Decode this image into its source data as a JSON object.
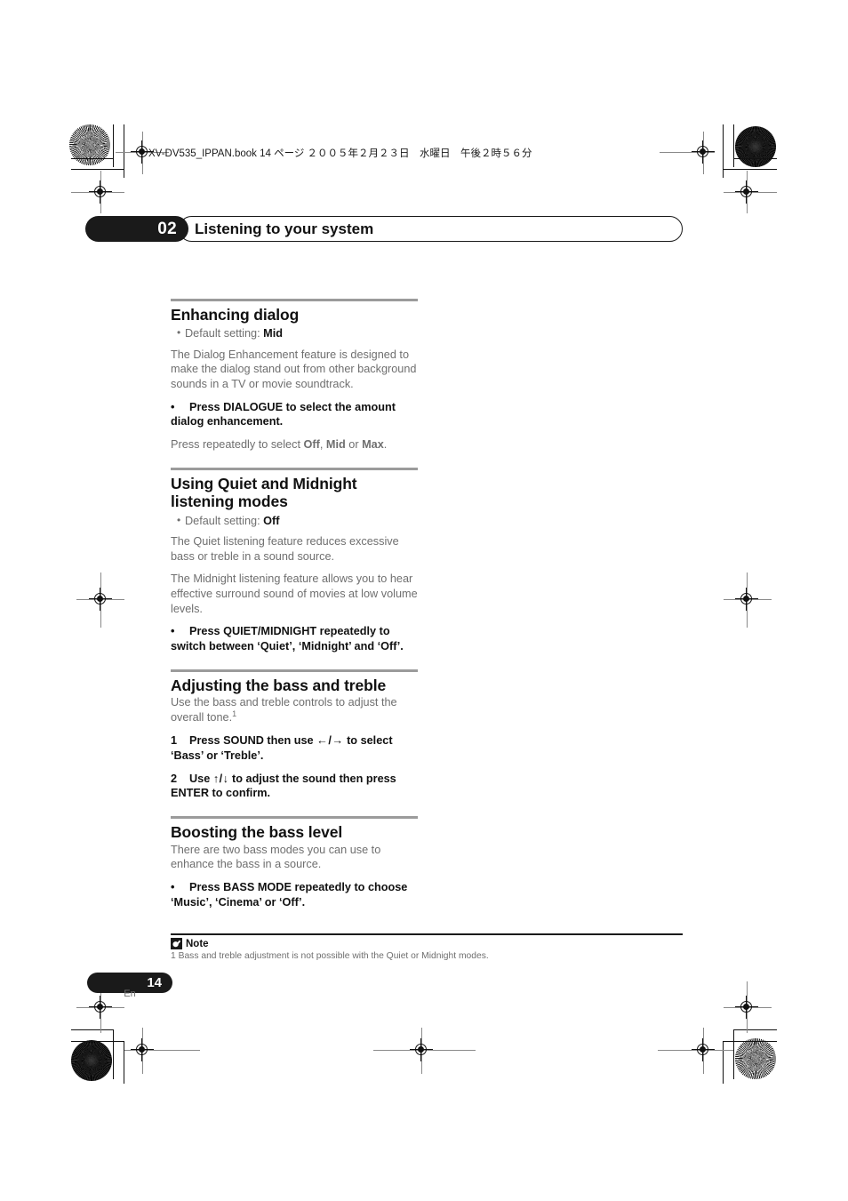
{
  "print_slug": "XV-DV535_IPPAN.book 14 ページ ２００５年２月２３日　水曜日　午後２時５６分",
  "header": {
    "chapter_number": "02",
    "chapter_title": "Listening to your system"
  },
  "sections": [
    {
      "heading": "Enhancing dialog",
      "default_prefix": "Default setting: ",
      "default_value": "Mid",
      "paragraphs": [
        "The Dialog Enhancement feature is designed to make the dialog stand out from other background sounds in a TV or movie soundtrack."
      ],
      "instruction_bullet": "•",
      "instruction": "Press DIALOGUE to select the amount dialog enhancement.",
      "after_paragraphs": [
        "Press repeatedly to select Off, Mid or Max."
      ]
    },
    {
      "heading": "Using Quiet and Midnight listening modes",
      "default_prefix": "Default setting: ",
      "default_value": "Off",
      "paragraphs": [
        "The Quiet listening feature reduces excessive bass or treble in a sound source.",
        "The Midnight listening feature allows you to hear effective surround sound of movies at low volume levels."
      ],
      "instruction_bullet": "•",
      "instruction": "Press QUIET/MIDNIGHT repeatedly to switch between ‘Quiet’, ‘Midnight’ and ‘Off’."
    },
    {
      "heading": "Adjusting the bass and treble",
      "paragraphs": [
        "Use the bass and treble controls to adjust the overall tone."
      ],
      "footnote_marker": "1",
      "steps": [
        {
          "number": "1",
          "text_before": "Press SOUND then use ",
          "arrows": "←/→",
          "text_after": " to select ‘Bass’ or ‘Treble’."
        },
        {
          "number": "2",
          "text_before": "Use ",
          "arrows": "↑/↓",
          "text_after": " to adjust the sound then press ENTER to confirm."
        }
      ]
    },
    {
      "heading": "Boosting the bass level",
      "paragraphs": [
        "There are two bass modes you can use to enhance the bass in a source."
      ],
      "instruction_bullet": "•",
      "instruction": "Press BASS MODE repeatedly to choose ‘Music’, ‘Cinema’ or ‘Off’."
    }
  ],
  "note": {
    "label": "Note",
    "icon": "note-pencil-icon",
    "text": "1 Bass and treble adjustment is not possible with the Quiet or Midnight modes."
  },
  "footer": {
    "page_number": "14",
    "language": "En"
  },
  "colors": {
    "ink": "#1a1a1a",
    "body_gray": "#6f6f6f",
    "rule_gray": "#9b9b9b"
  }
}
